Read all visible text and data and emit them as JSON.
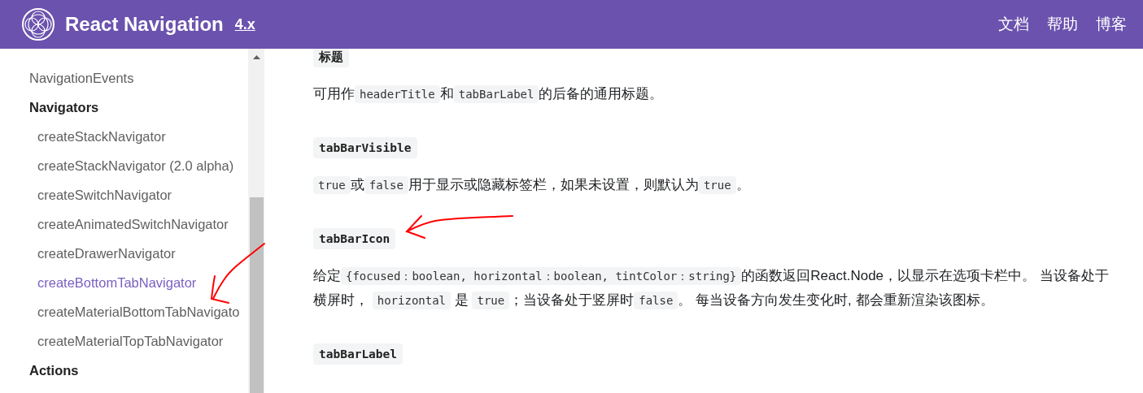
{
  "header": {
    "title": "React Navigation",
    "version": "4.x",
    "nav": [
      "文档",
      "帮助",
      "博客"
    ]
  },
  "sidebar": {
    "items": [
      {
        "kind": "link",
        "label": "NavigationEvents",
        "selected": false
      },
      {
        "kind": "category",
        "label": "Navigators"
      },
      {
        "kind": "sublink",
        "label": "createStackNavigator",
        "selected": false
      },
      {
        "kind": "sublink",
        "label": "createStackNavigator (2.0 alpha)",
        "selected": false
      },
      {
        "kind": "sublink",
        "label": "createSwitchNavigator",
        "selected": false
      },
      {
        "kind": "sublink",
        "label": "createAnimatedSwitchNavigator",
        "selected": false
      },
      {
        "kind": "sublink",
        "label": "createDrawerNavigator",
        "selected": false
      },
      {
        "kind": "sublink",
        "label": "createBottomTabNavigator",
        "selected": true
      },
      {
        "kind": "sublink",
        "label": "createMaterialBottomTabNavigato",
        "selected": false
      },
      {
        "kind": "sublink",
        "label": "createMaterialTopTabNavigator",
        "selected": false
      },
      {
        "kind": "category",
        "label": "Actions"
      }
    ]
  },
  "content": [
    {
      "kind": "heading",
      "code": "标题"
    },
    {
      "kind": "paragraph",
      "segments": [
        {
          "kind": "text",
          "text": "可用作"
        },
        {
          "kind": "code",
          "text": "headerTitle"
        },
        {
          "kind": "text",
          "text": "和"
        },
        {
          "kind": "code",
          "text": "tabBarLabel"
        },
        {
          "kind": "text",
          "text": "的后备的通用标题。"
        }
      ]
    },
    {
      "kind": "heading",
      "code": "tabBarVisible"
    },
    {
      "kind": "paragraph",
      "segments": [
        {
          "kind": "code",
          "text": "true"
        },
        {
          "kind": "text",
          "text": "或"
        },
        {
          "kind": "code",
          "text": "false"
        },
        {
          "kind": "text",
          "text": "用于显示或隐藏标签栏，如果未设置，则默认为"
        },
        {
          "kind": "code",
          "text": "true"
        },
        {
          "kind": "text",
          "text": "。"
        }
      ]
    },
    {
      "kind": "heading",
      "code": "tabBarIcon"
    },
    {
      "kind": "paragraph",
      "segments": [
        {
          "kind": "text",
          "text": "给定"
        },
        {
          "kind": "code",
          "text": "{focused：boolean, horizontal：boolean, tintColor：string}"
        },
        {
          "kind": "text",
          "text": "的函数返回React.Node，以显示在选项卡栏中。 当设备处于横屏时， "
        },
        {
          "kind": "code",
          "text": "horizontal"
        },
        {
          "kind": "text",
          "text": " 是 "
        },
        {
          "kind": "code",
          "text": "true"
        },
        {
          "kind": "text",
          "text": "；当设备处于竖屏时"
        },
        {
          "kind": "code",
          "text": "false"
        },
        {
          "kind": "text",
          "text": "。 每当设备方向发生变化时, 都会重新渲染该图标。"
        }
      ]
    },
    {
      "kind": "heading",
      "code": "tabBarLabel"
    }
  ],
  "annotations": [
    {
      "kind": "arrow"
    },
    {
      "kind": "arrow"
    }
  ]
}
